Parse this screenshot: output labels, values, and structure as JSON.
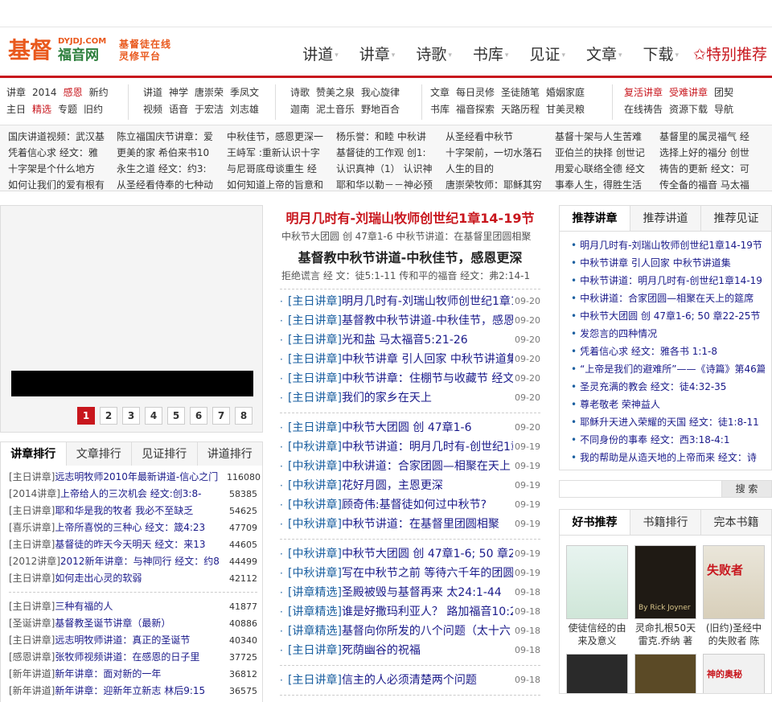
{
  "logo": {
    "big": "基督",
    "url": "DYJDJ.COM",
    "name": "福音网",
    "slogan1": "基督徒在线",
    "slogan2": "灵修平台"
  },
  "mainnav": [
    "讲道",
    "讲章",
    "诗歌",
    "书库",
    "见证",
    "文章",
    "下载"
  ],
  "featured_nav": "特别推荐",
  "subnav": [
    {
      "row1": [
        "讲章",
        "2014",
        "感恩",
        "新约"
      ],
      "row2": [
        "主日",
        "精选",
        "专题",
        "旧约"
      ]
    },
    {
      "row1": [
        "讲道",
        "神学",
        "唐崇荣",
        "季凤文"
      ],
      "row2": [
        "视频",
        "语音",
        "于宏洁",
        "刘志雄"
      ]
    },
    {
      "row1": [
        "诗歌",
        "赞美之泉",
        "我心旋律"
      ],
      "row2": [
        "迦南",
        "泥土音乐",
        "野地百合"
      ]
    },
    {
      "row1": [
        "文章",
        "每日灵修",
        "圣徒随笔",
        "婚姻家庭"
      ],
      "row2": [
        "书库",
        "福音探索",
        "天路历程",
        "甘美灵粮"
      ]
    },
    {
      "row1": [
        "复活讲章",
        "受难讲章",
        "团契"
      ],
      "row2": [
        "在线祷告",
        "资源下载",
        "导航"
      ]
    }
  ],
  "hot_links": [
    [
      "国庆讲道视频：武汉基",
      "凭着信心求 经文：雅",
      "十字架是个什么地方",
      "如何让我们的爱有根有"
    ],
    [
      "陈立福国庆节讲章：爱",
      "更美的家 希伯来书10",
      "永生之道 经文：约3:",
      "从圣经看侍奉的七种动"
    ],
    [
      "中秋佳节，感恩更深一",
      "王峙军 :重新认识十字",
      "与尼哥底母谈重生 经",
      "如何知道上帝的旨意和"
    ],
    [
      "杨乐誉：和睦 中秋讲",
      "基督徒的工作观 创1:",
      "认识真神（1） 认识神",
      "耶和华以勒－－神必预"
    ],
    [
      "从圣经看中秋节",
      "十字架前，一切水落石",
      "人生的目的",
      "唐崇荣牧师：耶稣其穷"
    ],
    [
      "基督十架与人生苦难",
      "亚伯兰的抉择 创世记",
      "用爱心联络全德 经文",
      "事奉人生，得胜生活"
    ],
    [
      "基督里的属灵福气 经",
      "选择上好的福分 创世",
      "祷告的更新 经文：可",
      "传全备的福音 马太福"
    ]
  ],
  "slider": {
    "pages": [
      "1",
      "2",
      "3",
      "4",
      "5",
      "6",
      "7",
      "8"
    ],
    "active_index": 0
  },
  "rank_tabs": [
    "讲章排行",
    "文章排行",
    "见证排行",
    "讲道排行"
  ],
  "rank_block1": [
    {
      "cat": "[主日讲章]",
      "title": "远志明牧师2010年最新讲道-信心之门",
      "count": "116080"
    },
    {
      "cat": "[2014讲章]",
      "title": "上帝给人的三次机会 经文:创3:8-",
      "count": "58385"
    },
    {
      "cat": "[主日讲章]",
      "title": "耶和华是我的牧者 我必不至缺乏",
      "count": "54625"
    },
    {
      "cat": "[喜乐讲章]",
      "title": "上帝所喜悦的三种心 经文：箴4:23",
      "count": "47709"
    },
    {
      "cat": "[主日讲章]",
      "title": "基督徒的昨天今天明天 经文：来13",
      "count": "44605"
    },
    {
      "cat": "[2012讲章]",
      "title": "2012新年讲章：与神同行 经文：约8",
      "count": "44499"
    },
    {
      "cat": "[主日讲章]",
      "title": "如何走出心灵的软弱",
      "count": "42112"
    }
  ],
  "rank_block2": [
    {
      "cat": "[主日讲章]",
      "title": "三种有福的人",
      "count": "41877"
    },
    {
      "cat": "[圣诞讲章]",
      "title": "基督教圣诞节讲章（最新）",
      "count": "40886"
    },
    {
      "cat": "[主日讲章]",
      "title": "远志明牧师讲道：真正的圣诞节",
      "count": "40340"
    },
    {
      "cat": "[感恩讲章]",
      "title": "张牧师视频讲道：在感恩的日子里",
      "count": "37725"
    },
    {
      "cat": "[新年讲道]",
      "title": "新年讲章：面对新的一年",
      "count": "36812"
    },
    {
      "cat": "[新年讲道]",
      "title": "新年讲章：迎新年立新志 林后9:15",
      "count": "36575"
    }
  ],
  "featured": {
    "title1": "明月几时有-刘瑞山牧师创世纪1章14-19节",
    "sub1": "中秋节大团圆 创 47章1-6 中秋节讲道：在基督里团圆相聚",
    "title2": "基督教中秋节讲道-中秋佳节，感恩更深",
    "sub2": "拒绝谎言 经 文：徒5:1-11 传和平的福音 经文：弗2:14-1"
  },
  "mid_list": [
    [
      {
        "cat": "[主日讲章]",
        "title": "明月几时有-刘瑞山牧师创世纪1章14-19节",
        "date": "09-20"
      },
      {
        "cat": "[主日讲章]",
        "title": "基督教中秋节讲道-中秋佳节，感恩更深",
        "date": "09-20"
      },
      {
        "cat": "[主日讲章]",
        "title": "光和盐 马太福音5:21-26",
        "date": "09-20"
      },
      {
        "cat": "[主日讲章]",
        "title": "中秋节讲章 引人回家 中秋节讲道集",
        "date": "09-20"
      },
      {
        "cat": "[主日讲章]",
        "title": "中秋节讲章：住棚节与收藏节 经文",
        "date": "09-20"
      },
      {
        "cat": "[主日讲章]",
        "title": "我们的家乡在天上",
        "date": "09-20"
      }
    ],
    [
      {
        "cat": "[主日讲章]",
        "title": "中秋节大团圆 创 47章1-6",
        "date": "09-20"
      },
      {
        "cat": "[中秋讲章]",
        "title": "中秋节讲道：明月几时有-创世纪1章",
        "date": "09-19"
      },
      {
        "cat": "[中秋讲章]",
        "title": "中秋讲道：合家团圆—相聚在天上",
        "date": "09-19"
      },
      {
        "cat": "[中秋讲章]",
        "title": "花好月圆，主恩更深",
        "date": "09-19"
      },
      {
        "cat": "[中秋讲章]",
        "title": "顾奇伟:基督徒如何过中秋节?",
        "date": "09-19"
      },
      {
        "cat": "[中秋讲章]",
        "title": "中秋节讲道：在基督里团圆相聚",
        "date": "09-19"
      }
    ],
    [
      {
        "cat": "[中秋讲章]",
        "title": "中秋节大团圆 创 47章1-6; 50 章22-25节",
        "date": "09-19"
      },
      {
        "cat": "[中秋讲章]",
        "title": "写在中秋节之前 等待六千年的团圆",
        "date": "09-19"
      },
      {
        "cat": "[讲章精选]",
        "title": "圣殿被毁与基督再来 太24:1-44",
        "date": "09-18"
      },
      {
        "cat": "[讲章精选]",
        "title": "谁是好撒玛利亚人？ 路加福音10:25",
        "date": "09-18"
      },
      {
        "cat": "[讲章精选]",
        "title": "基督向你所发的八个问题（太十六",
        "date": "09-18"
      },
      {
        "cat": "[主日讲章]",
        "title": "死荫幽谷的祝福",
        "date": "09-18"
      }
    ],
    [
      {
        "cat": "[主日讲章]",
        "title": "信主的人必须清楚两个问题",
        "date": "09-18"
      }
    ]
  ],
  "right_tabs": [
    "推荐讲章",
    "推荐讲道",
    "推荐见证"
  ],
  "right_list": [
    "明月几时有-刘瑞山牧师创世纪1章14-19节",
    "中秋节讲章 引人回家 中秋节讲道集",
    "中秋节讲道：明月几时有-创世纪1章14-19",
    "中秋讲道：合家团圆—相聚在天上的筵席",
    "中秋节大团圆 创 47章1-6; 50 章22-25节",
    "发怨言的四种情况",
    "凭着信心求 经文：雅各书 1:1-8",
    "“上帝是我们的避难所”——《诗篇》第46篇",
    "圣灵充满的教会 经文：徒4:32-35",
    "尊老敬老 荣神益人",
    "耶稣升天进入荣耀的天国 经文：徒1:8-11",
    "不同身份的事奉 经文：西3:18-4:1",
    "我的帮助是从造天地的上帝而来 经文：诗"
  ],
  "search": {
    "placeholder": "",
    "button": "搜 索"
  },
  "books_tabs": [
    "好书推荐",
    "书籍排行",
    "完本书籍"
  ],
  "books": [
    {
      "title": "使徒信经的由来及意义",
      "cover_text": ""
    },
    {
      "title": "灵命扎根50天 雷克.乔纳 著",
      "cover_text": "By Rick Joyner"
    },
    {
      "title": "(旧约)圣经中的失败者 陈",
      "cover_text": "失败者"
    }
  ],
  "books_row2_text": [
    "",
    "",
    "神的奥秘"
  ],
  "colors": {
    "brand_red": "#c8161d",
    "logo_orange": "#e9581c",
    "logo_green": "#2d7f3d",
    "link_blue": "#1a1a8a"
  }
}
